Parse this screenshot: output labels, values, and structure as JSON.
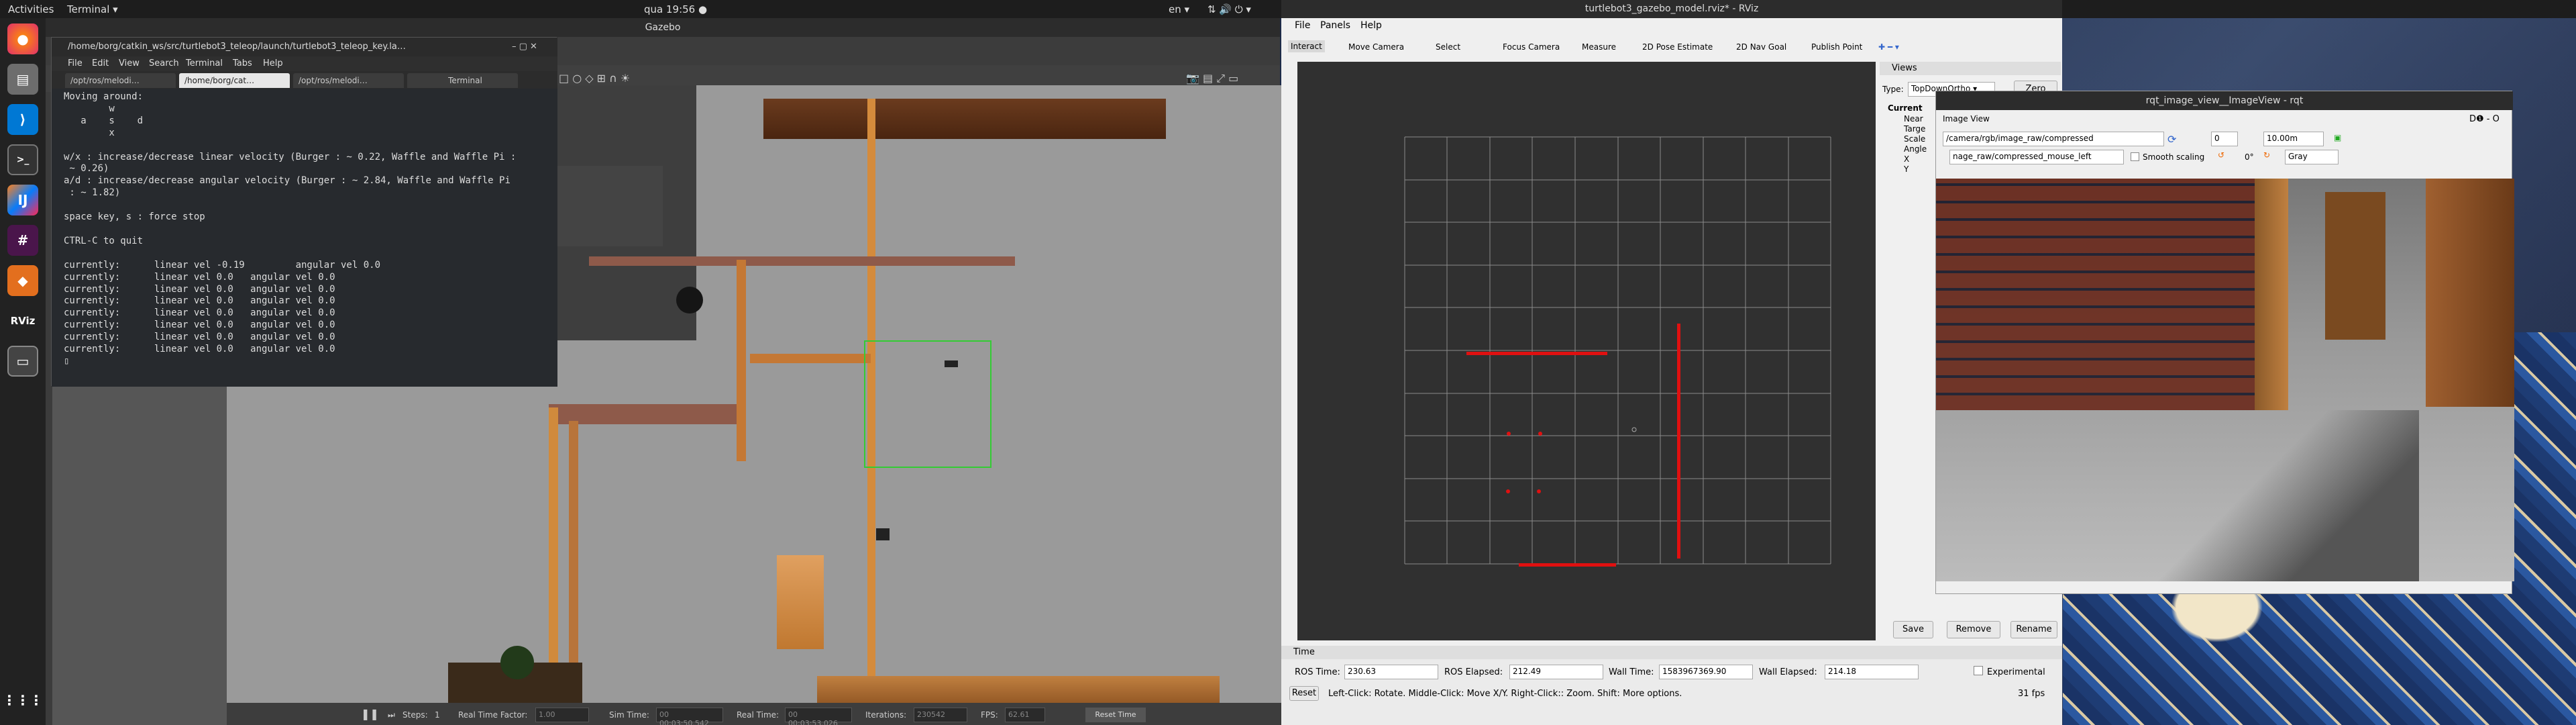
{
  "topbar": {
    "activities": "Activities",
    "app": "Terminal ▾",
    "clock": "qua 19:56 ●",
    "lang": "en ▾"
  },
  "dock": {
    "items": [
      "firefox-icon",
      "files-icon",
      "vscode-icon",
      "terminal-icon",
      "jetbrains-icon",
      "slack-icon",
      "package-icon",
      "rviz-icon",
      "window-icon",
      "apps-grid-icon"
    ],
    "rviz_label": "RViz"
  },
  "gazebo": {
    "title": "Gazebo",
    "steps_label": "Steps:",
    "steps_val": "1",
    "rtf_label": "Real Time Factor:",
    "rtf_val": "1.00",
    "sim_label": "Sim Time:",
    "sim_val": "00 00:03:50.542",
    "real_label": "Real Time:",
    "real_val": "00 00:03:53.026",
    "iter_label": "Iterations:",
    "iter_val": "230542",
    "fps_label": "FPS:",
    "fps_val": "62.61",
    "reset_time": "Reset Time"
  },
  "terminal": {
    "title": "/home/borg/catkin_ws/src/turtlebot3_teleop/launch/turtlebot3_teleop_key.la…",
    "menu": [
      "File",
      "Edit",
      "View",
      "Search",
      "Terminal",
      "Tabs",
      "Help"
    ],
    "tabs": [
      "/opt/ros/melodi…",
      "/home/borg/cat…",
      "/opt/ros/melodi…",
      "Terminal"
    ],
    "body": "Moving around:\n        w\n   a    s    d\n        x\n\nw/x : increase/decrease linear velocity (Burger : ~ 0.22, Waffle and Waffle Pi :\n ~ 0.26)\na/d : increase/decrease angular velocity (Burger : ~ 2.84, Waffle and Waffle Pi\n : ~ 1.82)\n\nspace key, s : force stop\n\nCTRL-C to quit\n\ncurrently:      linear vel -0.19         angular vel 0.0\ncurrently:      linear vel 0.0   angular vel 0.0\ncurrently:      linear vel 0.0   angular vel 0.0\ncurrently:      linear vel 0.0   angular vel 0.0\ncurrently:      linear vel 0.0   angular vel 0.0\ncurrently:      linear vel 0.0   angular vel 0.0\ncurrently:      linear vel 0.0   angular vel 0.0\ncurrently:      linear vel 0.0   angular vel 0.0\n▯"
  },
  "rviz": {
    "title": "turtlebot3_gazebo_model.rviz* - RViz",
    "menu": [
      "File",
      "Panels",
      "Help"
    ],
    "tools": [
      "Interact",
      "Move Camera",
      "Select",
      "Focus Camera",
      "Measure",
      "2D Pose Estimate",
      "2D Nav Goal",
      "Publish Point"
    ],
    "views_title": "Views",
    "type_label": "Type:",
    "type_val": "TopDownOrtho ▾",
    "zero": "Zero",
    "current": "Current",
    "props": [
      "Near",
      "Targe",
      "Scale",
      "Angle",
      "X",
      "Y"
    ],
    "save": "Save",
    "remove": "Remove",
    "rename": "Rename",
    "time_title": "Time",
    "ros_time_label": "ROS Time:",
    "ros_time": "230.63",
    "ros_elapsed_label": "ROS Elapsed:",
    "ros_elapsed": "212.49",
    "wall_time_label": "Wall Time:",
    "wall_time": "1583967369.90",
    "wall_elapsed_label": "Wall Elapsed:",
    "wall_elapsed": "214.18",
    "experimental": "Experimental",
    "reset": "Reset",
    "hint": "Left-Click: Rotate. Middle-Click: Move X/Y. Right-Click:: Zoom. Shift: More options.",
    "fps": "31 fps"
  },
  "imageview": {
    "title": "rqt_image_view__ImageView - rqt",
    "panel": "Image View",
    "topic": "/camera/rgb/image_raw/compressed",
    "num": "0",
    "dist": "10.00m",
    "mouse": "nage_raw/compressed_mouse_left",
    "smooth": "Smooth scaling",
    "deg": "0°",
    "color": "Gray",
    "dock_marks": "D❶ - O"
  }
}
